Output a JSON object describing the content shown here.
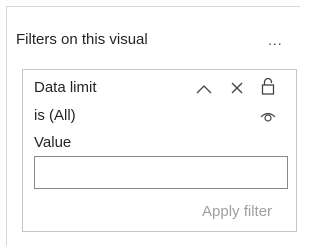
{
  "pane": {
    "title": "Filters on this visual",
    "more_label": "..."
  },
  "filter_card": {
    "title": "Data limit",
    "summary": "is (All)",
    "value_label": "Value",
    "value_input": "",
    "value_placeholder": "",
    "apply_label": "Apply filter",
    "icons": {
      "collapse": "chevron-up-icon",
      "clear": "close-icon",
      "lock": "lock-icon",
      "visibility": "eye-icon"
    }
  }
}
